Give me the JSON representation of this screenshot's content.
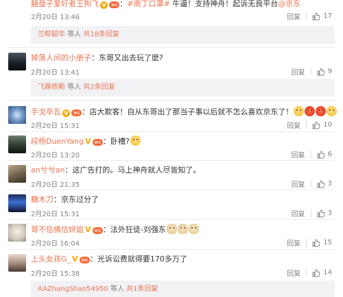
{
  "comments": [
    {
      "user": "囍盘子爱好者王狗飞",
      "badge": "ws",
      "text_topic": "#南丁口罩#",
      "text": " 牛逼！支持神舟！起诉无良平台",
      "mention": "@京东",
      "time": "2月20日 13:46",
      "reply": "回复",
      "likes": "17",
      "sub": {
        "name": "兰粽韶华",
        "text": " 等人 ",
        "count": "共18条回复"
      }
    },
    {
      "user": "掉落人间的小册子",
      "badge": "",
      "text": "东哥又出去玩了麽?",
      "time": "2月20日 13:41",
      "reply": "回复",
      "likes": "9",
      "sub": {
        "name": "飞霖梧勒",
        "text": " 等人 ",
        "count": "共2条回复"
      }
    },
    {
      "user": "手戈卒瓦",
      "badge": "ws",
      "text": "店大欺客！自从东哥出了那当子事以后就不怎么喜欢京东了！",
      "time": "2月20日 15:31",
      "reply": "回复",
      "likes": "10",
      "emojis": [
        "tears",
        "angry",
        "angry",
        "tears"
      ]
    },
    {
      "user": "段杨DuenYang",
      "badge": "yv",
      "text": "卧槽?",
      "time": "2月20日 13:20",
      "reply": "回复",
      "likes": "6",
      "emojis": [
        "smile"
      ]
    },
    {
      "user": "an兮兮an",
      "badge": "",
      "text": "这广告打的。马上神舟就人尽皆知了。",
      "time": "2月20日 21:35",
      "reply": "回复",
      "likes": "3"
    },
    {
      "user": "糖木刀",
      "badge": "",
      "text": "京东过分了",
      "time": "2月20日 15:31",
      "reply": "回复",
      "likes": "3"
    },
    {
      "user": "哥不信佛信妍姐",
      "badge": "yv",
      "text": "法外狂徒-刘强东",
      "time": "2月20日 16:04",
      "reply": "回复",
      "likes": "15",
      "emojis": [
        "doge",
        "doge",
        "doge"
      ]
    },
    {
      "user": "上头女孩G_",
      "badge": "yv",
      "text": "光诉讼费就得要170多万了",
      "time": "2月20日 15:38",
      "reply": "回复",
      "likes": "14",
      "sub": {
        "name": "AAZhangShao54950",
        "text": " 等人 ",
        "count": "共1条回复"
      }
    }
  ],
  "colors": {
    "accent": "#eb7350",
    "meta": "#808080",
    "subbg": "#f2f2f5",
    "badge": "#f2a800"
  },
  "icons": {
    "like": "thumb-up-icon",
    "vip": "weibo-vip-badge-icon"
  }
}
